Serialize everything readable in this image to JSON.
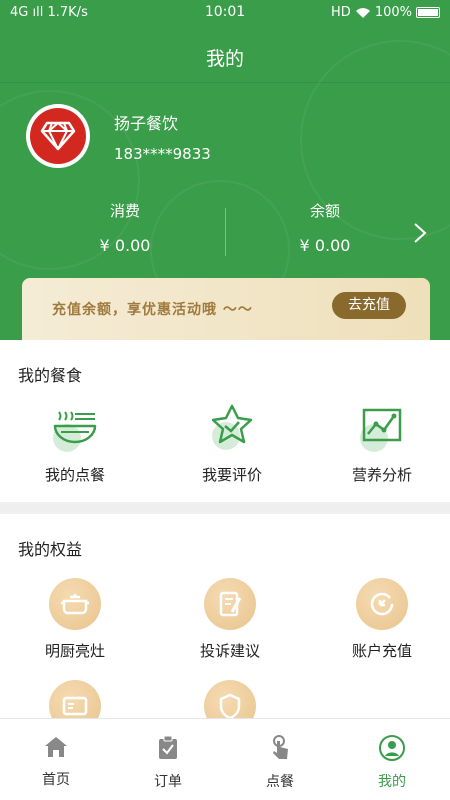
{
  "status_bar": {
    "network": "4G",
    "signal": "ıll",
    "speed": "1.7K/s",
    "time": "10:01",
    "hd": "HD",
    "battery": "100%"
  },
  "page_title": "我的",
  "user": {
    "name": "扬子餐饮",
    "phone": "183****9833"
  },
  "stats": [
    {
      "label": "消费",
      "value": "¥ 0.00"
    },
    {
      "label": "余额",
      "value": "¥ 0.00"
    }
  ],
  "banner": {
    "text": "充值余额，享优惠活动哦 ～～",
    "button": "去充值"
  },
  "meal_section": {
    "title": "我的餐食",
    "items": [
      {
        "label": "我的点餐",
        "icon": "bowl-icon"
      },
      {
        "label": "我要评价",
        "icon": "star-icon"
      },
      {
        "label": "营养分析",
        "icon": "chart-icon"
      }
    ]
  },
  "rights_section": {
    "title": "我的权益",
    "items": [
      {
        "label": "明厨亮灶",
        "icon": "pot-icon"
      },
      {
        "label": "投诉建议",
        "icon": "feedback-icon"
      },
      {
        "label": "账户充值",
        "icon": "recharge-icon"
      },
      {
        "label": "",
        "icon": "id-card-icon"
      },
      {
        "label": "",
        "icon": "shield-icon"
      }
    ]
  },
  "tabbar": [
    {
      "label": "首页",
      "icon": "home-icon",
      "active": false
    },
    {
      "label": "订单",
      "icon": "order-icon",
      "active": false
    },
    {
      "label": "点餐",
      "icon": "tap-icon",
      "active": false
    },
    {
      "label": "我的",
      "icon": "user-icon",
      "active": true
    }
  ],
  "colors": {
    "primary": "#3a9d4a",
    "accent_gold": "#8a6a2c",
    "avatar_red": "#d32820"
  }
}
